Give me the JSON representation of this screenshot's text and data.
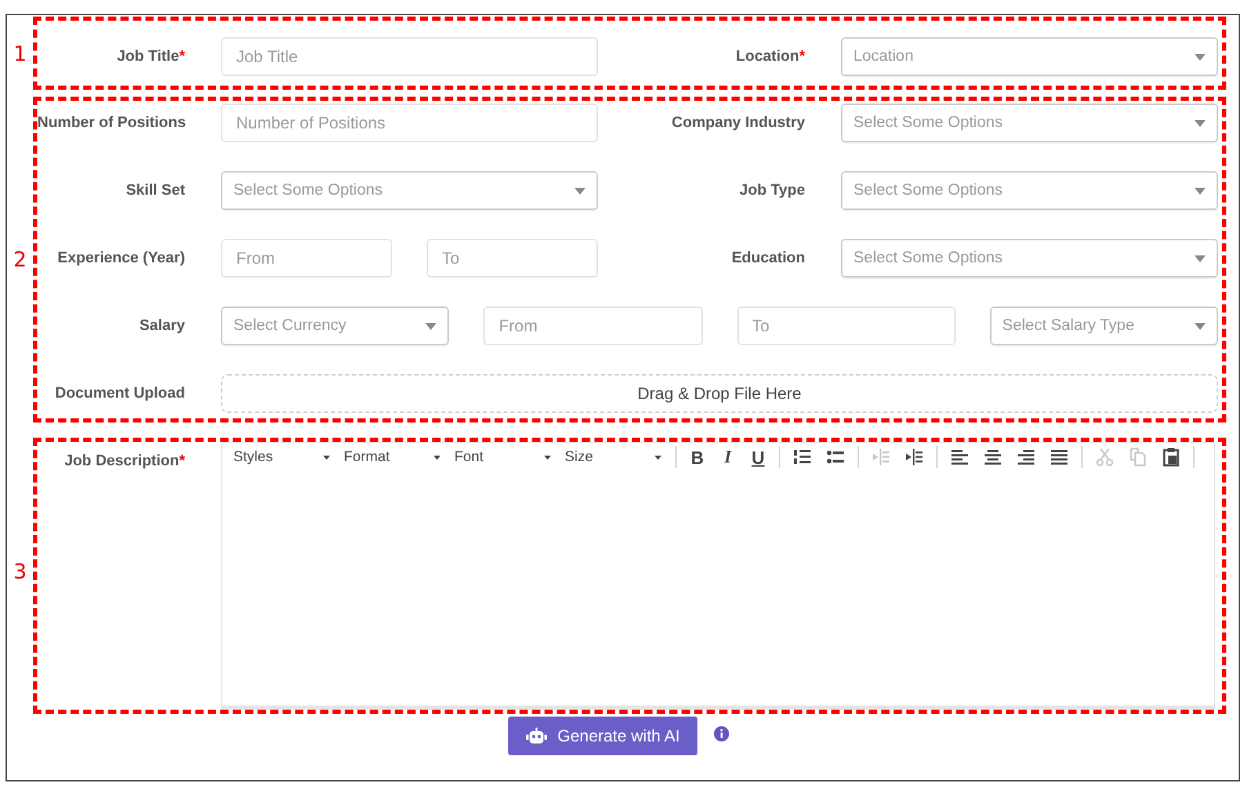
{
  "sections": [
    {
      "marker": "1",
      "rows": [
        {
          "kind": "pair",
          "fields": [
            {
              "label": "Job Title",
              "mark": "*",
              "controls": [
                {
                  "kind": "input",
                  "placeholder": "Job Title"
                }
              ]
            },
            {
              "label": "Location",
              "mark": "*",
              "controls": [
                {
                  "kind": "select",
                  "placeholder": "Location"
                }
              ]
            }
          ]
        }
      ]
    },
    {
      "marker": "2",
      "rows": [
        {
          "kind": "pair",
          "fields": [
            {
              "label": "Number of Positions",
              "controls": [
                {
                  "kind": "input",
                  "placeholder": "Number of Positions"
                }
              ]
            },
            {
              "label": "Company Industry",
              "controls": [
                {
                  "kind": "select",
                  "placeholder": "Select Some Options"
                }
              ]
            }
          ]
        },
        {
          "kind": "pair",
          "fields": [
            {
              "label": "Skill Set",
              "controls": [
                {
                  "kind": "select",
                  "placeholder": "Select Some Options"
                }
              ]
            },
            {
              "label": "Job Type",
              "controls": [
                {
                  "kind": "select",
                  "placeholder": "Select Some Options"
                }
              ]
            }
          ]
        },
        {
          "kind": "pair",
          "fields": [
            {
              "label": "Experience (Year)",
              "controls": [
                {
                  "kind": "input",
                  "placeholder": "From"
                },
                {
                  "kind": "input",
                  "placeholder": "To"
                }
              ]
            },
            {
              "label": "Education",
              "controls": [
                {
                  "kind": "select",
                  "placeholder": "Select Some Options"
                }
              ]
            }
          ]
        },
        {
          "kind": "wide",
          "fields": [
            {
              "label": "Salary",
              "controls": [
                {
                  "kind": "select",
                  "placeholder": "Select Currency"
                },
                {
                  "kind": "input",
                  "placeholder": "From"
                },
                {
                  "kind": "input",
                  "placeholder": "To"
                },
                {
                  "kind": "select",
                  "placeholder": "Select Salary Type"
                }
              ]
            }
          ]
        },
        {
          "kind": "wide",
          "fields": [
            {
              "label": "Document Upload",
              "controls": [
                {
                  "kind": "dropzone",
                  "text": "Drag & Drop File Here"
                }
              ]
            }
          ]
        }
      ]
    },
    {
      "marker": "3",
      "editor": {
        "label": "Job Description",
        "mark": "*",
        "toolbar": [
          {
            "kind": "dropdown",
            "label": "Styles"
          },
          {
            "kind": "dropdown",
            "label": "Format"
          },
          {
            "kind": "dropdown",
            "label": "Font"
          },
          {
            "kind": "dropdown",
            "label": "Size"
          },
          {
            "kind": "separator"
          },
          {
            "kind": "letter",
            "label": "B"
          },
          {
            "kind": "letter",
            "label": "I"
          },
          {
            "kind": "letter",
            "label": "U"
          },
          {
            "kind": "separator"
          },
          {
            "kind": "icon",
            "disabled": false
          },
          {
            "kind": "icon",
            "disabled": false
          },
          {
            "kind": "separator"
          },
          {
            "kind": "icon",
            "disabled": true
          },
          {
            "kind": "icon",
            "disabled": false
          },
          {
            "kind": "separator"
          },
          {
            "kind": "icon",
            "disabled": false
          },
          {
            "kind": "icon",
            "disabled": false
          },
          {
            "kind": "icon",
            "disabled": false
          },
          {
            "kind": "icon",
            "disabled": false
          },
          {
            "kind": "separator"
          },
          {
            "kind": "icon",
            "disabled": true
          },
          {
            "kind": "icon",
            "disabled": true
          },
          {
            "kind": "icon",
            "disabled": false
          },
          {
            "kind": "separator"
          }
        ]
      }
    }
  ],
  "action": {
    "label": "Generate with AI"
  }
}
